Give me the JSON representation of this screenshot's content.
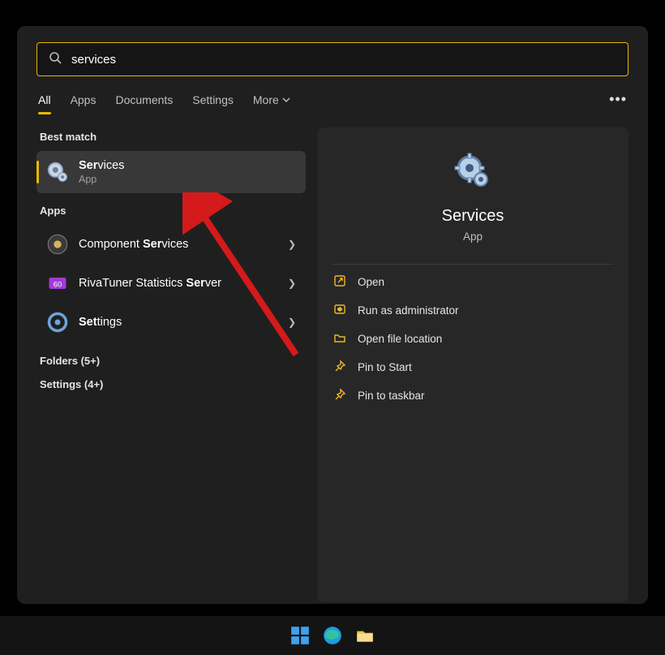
{
  "search": {
    "value": "services"
  },
  "tabs": {
    "all": "All",
    "apps": "Apps",
    "documents": "Documents",
    "settings": "Settings",
    "more": "More"
  },
  "left": {
    "best_match_label": "Best match",
    "best_match": {
      "title_bold": "Ser",
      "title_rest": "vices",
      "subtitle": "App"
    },
    "apps_label": "Apps",
    "apps": [
      {
        "title_pre": "Component ",
        "title_bold": "Ser",
        "title_post": "vices"
      },
      {
        "title_pre": "RivaTuner Statistics ",
        "title_bold": "Ser",
        "title_post": "ver"
      },
      {
        "title_pre": "",
        "title_bold": "Set",
        "title_post": "tings"
      }
    ],
    "folders_label": "Folders (5+)",
    "settings_label": "Settings (4+)"
  },
  "preview": {
    "title": "Services",
    "subtitle": "App",
    "actions": {
      "open": "Open",
      "admin": "Run as administrator",
      "location": "Open file location",
      "pin_start": "Pin to Start",
      "pin_taskbar": "Pin to taskbar"
    }
  },
  "colors": {
    "accent": "#e6b900",
    "action_icon": "#f2b429"
  }
}
